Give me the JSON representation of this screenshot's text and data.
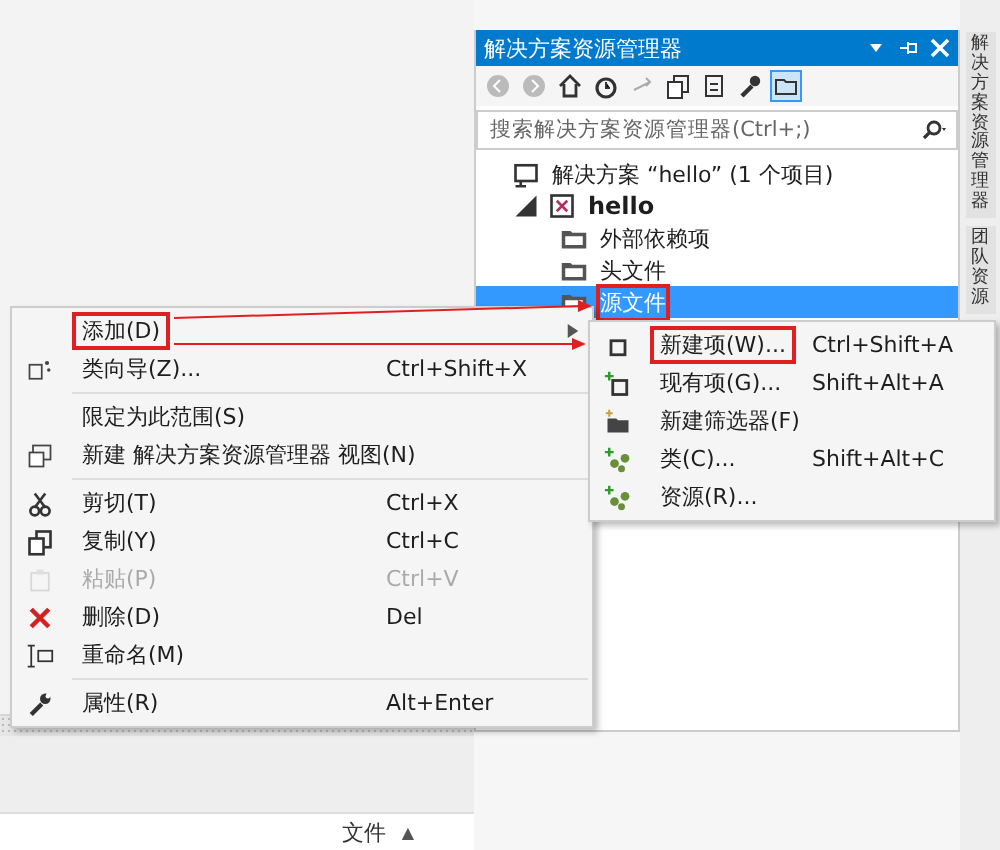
{
  "explorer": {
    "title": "解决方案资源管理器",
    "search": {
      "placeholder": "搜索解决方案资源管理器(Ctrl+;)"
    },
    "tree": [
      {
        "label": "解决方案 “hello” (1 个项目)",
        "kind": "solution",
        "selected": false,
        "marked": false,
        "children": [
          {
            "label": "hello",
            "kind": "project",
            "selected": false,
            "marked": false,
            "expanded": true,
            "children": [
              {
                "label": "外部依赖项",
                "kind": "folder",
                "selected": false,
                "marked": false
              },
              {
                "label": "头文件",
                "kind": "folder",
                "selected": false,
                "marked": false
              },
              {
                "label": "源文件",
                "kind": "folder",
                "selected": true,
                "marked": true
              }
            ]
          }
        ]
      }
    ]
  },
  "side_tabs": [
    "解决方案资源管理器",
    "团队资源"
  ],
  "context_menu": {
    "items": [
      {
        "kind": "item",
        "label": "添加(D)",
        "disabled": false,
        "marked": true,
        "submenu": true
      },
      {
        "kind": "item",
        "label": "类向导(Z)...",
        "shortcut": "Ctrl+Shift+X",
        "disabled": false,
        "marked": false,
        "submenu": false
      },
      {
        "kind": "separator"
      },
      {
        "kind": "item",
        "label": "限定为此范围(S)",
        "disabled": false,
        "marked": false,
        "submenu": false
      },
      {
        "kind": "item",
        "label": "新建 解决方案资源管理器 视图(N)",
        "disabled": false,
        "marked": false,
        "submenu": false
      },
      {
        "kind": "separator"
      },
      {
        "kind": "item",
        "label": "剪切(T)",
        "shortcut": "Ctrl+X",
        "disabled": false,
        "marked": false,
        "submenu": false
      },
      {
        "kind": "item",
        "label": "复制(Y)",
        "shortcut": "Ctrl+C",
        "disabled": false,
        "marked": false,
        "submenu": false
      },
      {
        "kind": "item",
        "label": "粘贴(P)",
        "shortcut": "Ctrl+V",
        "disabled": true,
        "marked": false,
        "submenu": false
      },
      {
        "kind": "item",
        "label": "删除(D)",
        "shortcut": "Del",
        "disabled": false,
        "marked": false,
        "submenu": false
      },
      {
        "kind": "item",
        "label": "重命名(M)",
        "disabled": false,
        "marked": false,
        "submenu": false
      },
      {
        "kind": "separator"
      },
      {
        "kind": "item",
        "label": "属性(R)",
        "shortcut": "Alt+Enter",
        "disabled": false,
        "marked": false,
        "submenu": false
      }
    ]
  },
  "submenu": {
    "items": [
      {
        "kind": "item",
        "label": "新建项(W)...",
        "shortcut": "Ctrl+Shift+A",
        "disabled": false,
        "marked": true,
        "submenu": false
      },
      {
        "kind": "item",
        "label": "现有项(G)...",
        "shortcut": "Shift+Alt+A",
        "disabled": false,
        "marked": false,
        "submenu": false
      },
      {
        "kind": "item",
        "label": "新建筛选器(F)",
        "disabled": false,
        "marked": false,
        "submenu": false
      },
      {
        "kind": "item",
        "label": "类(C)...",
        "shortcut": "Shift+Alt+C",
        "disabled": false,
        "marked": false,
        "submenu": false
      },
      {
        "kind": "item",
        "label": "资源(R)...",
        "disabled": false,
        "marked": false,
        "submenu": false
      }
    ]
  },
  "bottom_pane": {
    "column": "文件",
    "sort_arrow": "▲"
  }
}
